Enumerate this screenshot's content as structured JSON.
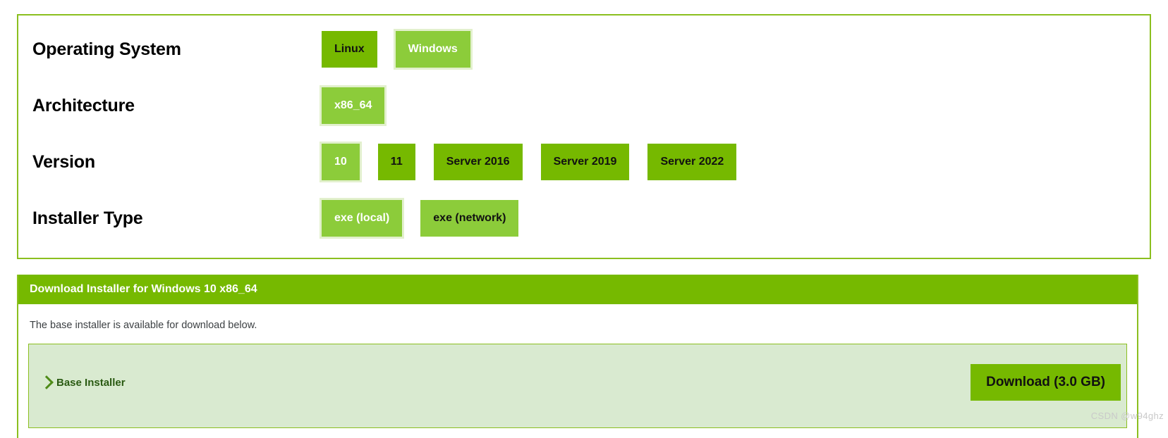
{
  "selector": {
    "rows": [
      {
        "label": "Operating System",
        "options": [
          {
            "text": "Linux",
            "state": "unselected"
          },
          {
            "text": "Windows",
            "state": "selected"
          }
        ]
      },
      {
        "label": "Architecture",
        "options": [
          {
            "text": "x86_64",
            "state": "selected"
          }
        ]
      },
      {
        "label": "Version",
        "options": [
          {
            "text": "10",
            "state": "selected"
          },
          {
            "text": "11",
            "state": "unselected"
          },
          {
            "text": "Server 2016",
            "state": "unselected"
          },
          {
            "text": "Server 2019",
            "state": "unselected"
          },
          {
            "text": "Server 2022",
            "state": "unselected"
          }
        ]
      },
      {
        "label": "Installer Type",
        "options": [
          {
            "text": "exe (local)",
            "state": "selected"
          },
          {
            "text": "exe (network)",
            "state": "light"
          }
        ]
      }
    ]
  },
  "download": {
    "header_title": "Download Installer for Windows 10 x86_64",
    "description": "The base installer is available for download below.",
    "installer_name": "Base Installer",
    "download_button": "Download (3.0 GB)"
  },
  "watermark": "CSDN @w94ghz",
  "colors": {
    "nvidia_green": "#76b900",
    "light_green": "#8ccc3a",
    "panel_border": "#8bbf1f",
    "installer_bg": "#d9ead0",
    "base_installer_text": "#2a5a12"
  }
}
